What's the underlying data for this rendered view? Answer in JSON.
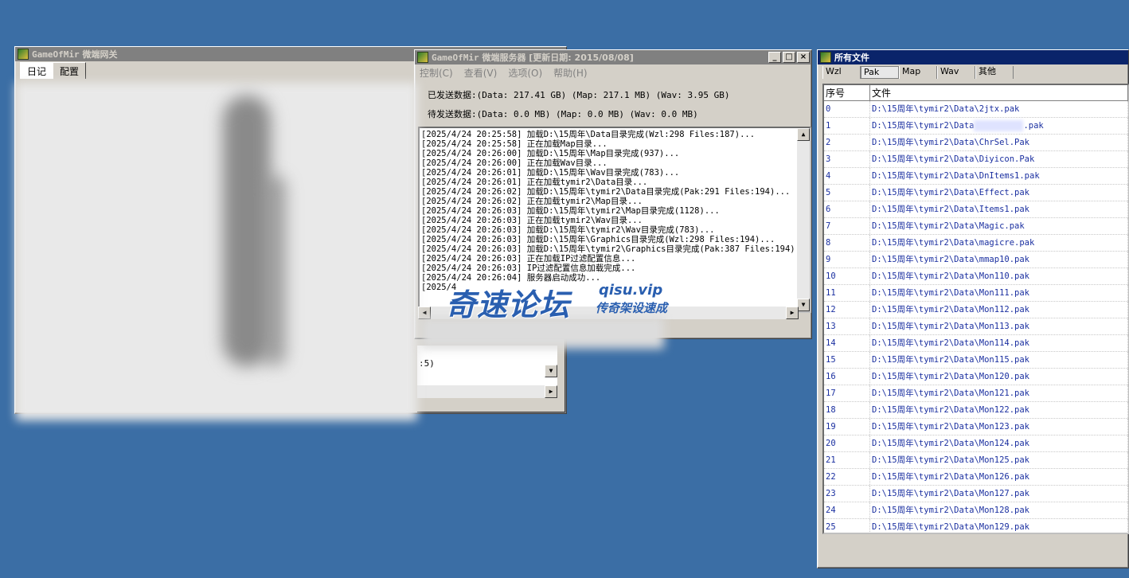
{
  "gateway": {
    "title_app": "GameOfMir",
    "title_name": "微端网关",
    "tabs": [
      "日记",
      "配置"
    ]
  },
  "server": {
    "title_app": "GameOfMir",
    "title_name": "微端服务器 [更新日期: 2015/08/08]",
    "menu": [
      "控制(C)",
      "查看(V)",
      "选项(O)",
      "帮助(H)"
    ],
    "sent": "已发送数据:(Data: 217.41 GB) (Map: 217.1 MB) (Wav: 3.95 GB)",
    "pending": "待发送数据:(Data: 0.0 MB) (Map: 0.0 MB) (Wav: 0.0 MB)",
    "log": [
      "[2025/4/24 20:25:58] 加载D:\\15周年\\Data目录完成(Wzl:298 Files:187)...",
      "[2025/4/24 20:25:58] 正在加载Map目录...",
      "[2025/4/24 20:26:00] 加载D:\\15周年\\Map目录完成(937)...",
      "[2025/4/24 20:26:00] 正在加载Wav目录...",
      "[2025/4/24 20:26:01] 加载D:\\15周年\\Wav目录完成(783)...",
      "[2025/4/24 20:26:01] 正在加载tymir2\\Data目录...",
      "[2025/4/24 20:26:02] 加载D:\\15周年\\tymir2\\Data目录完成(Pak:291 Files:194)...",
      "[2025/4/24 20:26:02] 正在加载tymir2\\Map目录...",
      "[2025/4/24 20:26:03] 加载D:\\15周年\\tymir2\\Map目录完成(1128)...",
      "[2025/4/24 20:26:03] 正在加载tymir2\\Wav目录...",
      "[2025/4/24 20:26:03] 加载D:\\15周年\\tymir2\\Wav目录完成(783)...",
      "[2025/4/24 20:26:03] 加载D:\\15周年\\Graphics目录完成(Wzl:298 Files:194)...",
      "[2025/4/24 20:26:03] 加载D:\\15周年\\tymir2\\Graphics目录完成(Pak:387 Files:194)...",
      "[2025/4/24 20:26:03] 正在加载IP过滤配置信息...",
      "[2025/4/24 20:26:03] IP过滤配置信息加载完成...",
      "[2025/4/24 20:26:04] 服务器启动成功...",
      "[2025/4"
    ],
    "lower_text": ":5)"
  },
  "files": {
    "title": "所有文件",
    "tabs": [
      "Wzl",
      "Pak",
      "Map",
      "Wav",
      "其他"
    ],
    "selected_tab": "Pak",
    "columns": [
      "序号",
      "文件"
    ],
    "rows": [
      {
        "idx": "0",
        "file": "D:\\15周年\\tymir2\\Data\\2jtx.pak"
      },
      {
        "idx": "1",
        "file": "D:\\15周年\\tymir2\\Data"
      },
      {
        "idx": "2",
        "file": "D:\\15周年\\tymir2\\Data\\ChrSel.Pak"
      },
      {
        "idx": "3",
        "file": "D:\\15周年\\tymir2\\Data\\Diyicon.Pak"
      },
      {
        "idx": "4",
        "file": "D:\\15周年\\tymir2\\Data\\DnItems1.pak"
      },
      {
        "idx": "5",
        "file": "D:\\15周年\\tymir2\\Data\\Effect.pak"
      },
      {
        "idx": "6",
        "file": "D:\\15周年\\tymir2\\Data\\Items1.pak"
      },
      {
        "idx": "7",
        "file": "D:\\15周年\\tymir2\\Data\\Magic.pak"
      },
      {
        "idx": "8",
        "file": "D:\\15周年\\tymir2\\Data\\magicre.pak"
      },
      {
        "idx": "9",
        "file": "D:\\15周年\\tymir2\\Data\\mmap10.pak"
      },
      {
        "idx": "10",
        "file": "D:\\15周年\\tymir2\\Data\\Mon110.pak"
      },
      {
        "idx": "11",
        "file": "D:\\15周年\\tymir2\\Data\\Mon111.pak"
      },
      {
        "idx": "12",
        "file": "D:\\15周年\\tymir2\\Data\\Mon112.pak"
      },
      {
        "idx": "13",
        "file": "D:\\15周年\\tymir2\\Data\\Mon113.pak"
      },
      {
        "idx": "14",
        "file": "D:\\15周年\\tymir2\\Data\\Mon114.pak"
      },
      {
        "idx": "15",
        "file": "D:\\15周年\\tymir2\\Data\\Mon115.pak"
      },
      {
        "idx": "16",
        "file": "D:\\15周年\\tymir2\\Data\\Mon120.pak"
      },
      {
        "idx": "17",
        "file": "D:\\15周年\\tymir2\\Data\\Mon121.pak"
      },
      {
        "idx": "18",
        "file": "D:\\15周年\\tymir2\\Data\\Mon122.pak"
      },
      {
        "idx": "19",
        "file": "D:\\15周年\\tymir2\\Data\\Mon123.pak"
      },
      {
        "idx": "20",
        "file": "D:\\15周年\\tymir2\\Data\\Mon124.pak"
      },
      {
        "idx": "21",
        "file": "D:\\15周年\\tymir2\\Data\\Mon125.pak"
      },
      {
        "idx": "22",
        "file": "D:\\15周年\\tymir2\\Data\\Mon126.pak"
      },
      {
        "idx": "23",
        "file": "D:\\15周年\\tymir2\\Data\\Mon127.pak"
      },
      {
        "idx": "24",
        "file": "D:\\15周年\\tymir2\\Data\\Mon128.pak"
      },
      {
        "idx": "25",
        "file": "D:\\15周年\\tymir2\\Data\\Mon129.pak"
      }
    ],
    "row1_suffix": ".pak"
  },
  "watermark": {
    "brand": "奇速论坛",
    "url": "qisu.vip",
    "slogan": "传奇架设速成"
  }
}
